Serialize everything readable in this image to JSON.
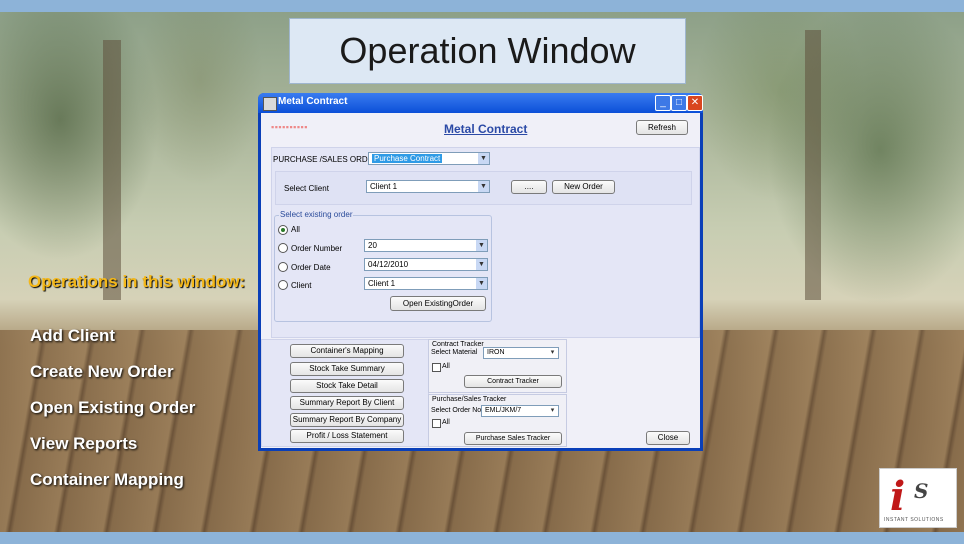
{
  "banner_title": "Operation Window",
  "operations": {
    "heading": "Operations in this window:",
    "items": [
      "Add Client",
      "Create New Order",
      "Open Existing Order",
      "View Reports",
      "Container Mapping"
    ]
  },
  "window": {
    "title": "Metal Contract",
    "header_title": "Metal Contract",
    "refresh_label": "Refresh",
    "purchase_sales": {
      "label": "PURCHASE /SALES ORDER",
      "value": "Purchase Contract"
    },
    "client": {
      "label": "Select Client",
      "value": "Client 1",
      "dots_label": "....",
      "new_order_label": "New Order"
    },
    "existing_order": {
      "group_title": "Select existing order",
      "all_label": "All",
      "order_number_label": "Order Number",
      "order_number_value": "20",
      "order_date_label": "Order Date",
      "order_date_value": "04/12/2010",
      "client_label": "Client",
      "client_value": "Client 1",
      "open_label": "Open ExistingOrder"
    },
    "reports": [
      "Container's Mapping",
      "Stock Take Summary",
      "Stock Take Detail",
      "Summary Report By Client",
      "Summary Report By Company",
      "Profit / Loss Statement"
    ],
    "contract_tracker": {
      "title": "Contract Tracker",
      "select_label": "Select Material",
      "value": "IRON",
      "all_label": "All",
      "button": "Contract Tracker"
    },
    "ps_tracker": {
      "title": "Purchase/Sales Tracker",
      "select_label": "Select Order No",
      "value": "EML/JKM/7",
      "all_label": "All",
      "button": "Purchase Sales Tracker"
    },
    "close_label": "Close"
  },
  "logo": {
    "mark_i": "i",
    "mark_s": "S",
    "tagline": "INSTANT SOLUTIONS"
  }
}
